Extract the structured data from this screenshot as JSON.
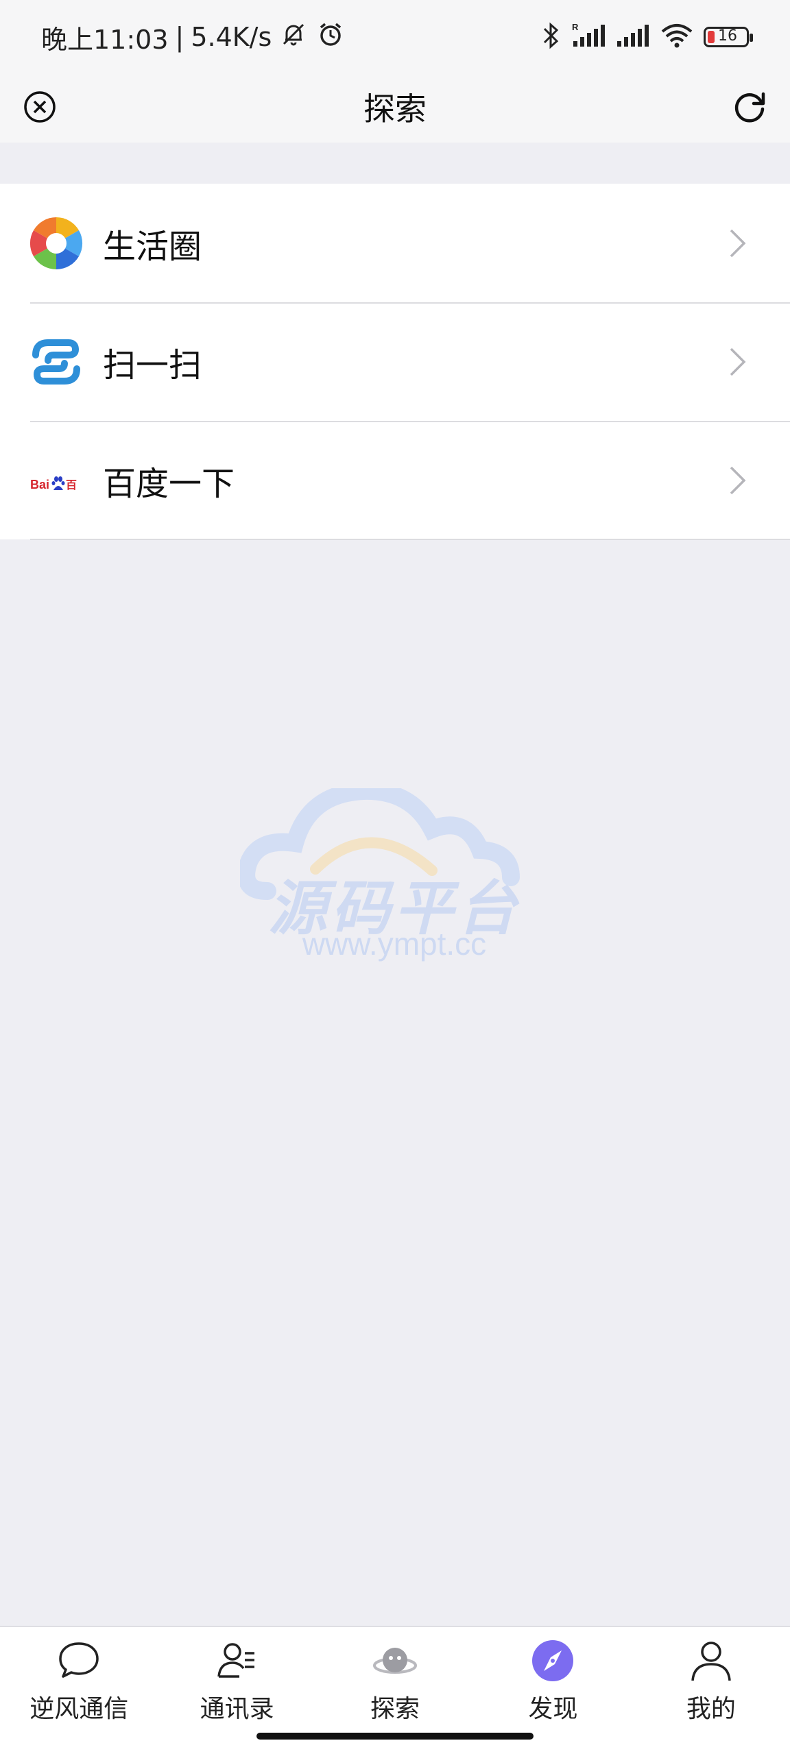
{
  "status_bar": {
    "time": "晚上11:03",
    "separator": "|",
    "net_speed": "5.4K/s",
    "battery_level": "16",
    "icons": [
      "mute-bell-icon",
      "alarm-icon",
      "bluetooth-icon",
      "signal-r-icon",
      "signal-icon",
      "wifi-icon",
      "battery-icon"
    ]
  },
  "header": {
    "title": "探索",
    "left_icon": "close-circle-icon",
    "right_icon": "refresh-icon"
  },
  "menu": {
    "items": [
      {
        "label": "生活圈",
        "icon": "aperture-icon"
      },
      {
        "label": "扫一扫",
        "icon": "scan-icon"
      },
      {
        "label": "百度一下",
        "icon": "baidu-logo-icon"
      }
    ]
  },
  "watermark": {
    "title": "源码平台",
    "url": "www.ympt.cc"
  },
  "tab_bar": {
    "active_color": "#7c6cf0",
    "tabs": [
      {
        "label": "逆风通信",
        "icon": "chat-bubble-icon"
      },
      {
        "label": "通讯录",
        "icon": "contacts-icon"
      },
      {
        "label": "探索",
        "icon": "planet-icon"
      },
      {
        "label": "发现",
        "icon": "compass-icon",
        "active": true
      },
      {
        "label": "我的",
        "icon": "person-icon"
      }
    ]
  }
}
